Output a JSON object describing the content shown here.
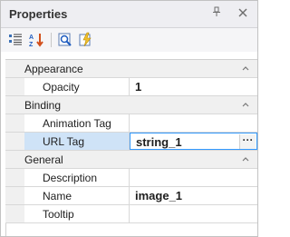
{
  "panel": {
    "title": "Properties",
    "pin_icon": "pin-icon",
    "close_icon": "close-icon"
  },
  "toolbar": {
    "buttons": [
      {
        "icon": "categorized-icon"
      },
      {
        "icon": "alphabetical-sort-icon"
      },
      {
        "icon": "property-pages-icon"
      },
      {
        "icon": "events-icon"
      }
    ]
  },
  "categories": [
    {
      "label": "Appearance",
      "properties": [
        {
          "name": "Opacity",
          "value": "1"
        }
      ]
    },
    {
      "label": "Binding",
      "properties": [
        {
          "name": "Animation Tag",
          "value": ""
        },
        {
          "name": "URL Tag",
          "value": "string_1",
          "selected": true,
          "button_label": "···"
        }
      ]
    },
    {
      "label": "General",
      "properties": [
        {
          "name": "Description",
          "value": ""
        },
        {
          "name": "Name",
          "value": "image_1"
        },
        {
          "name": "Tooltip",
          "value": ""
        }
      ]
    }
  ],
  "colors": {
    "selection": "#cfe3f7",
    "edit_border": "#3399ff",
    "category_bg": "#f0f0f0"
  }
}
